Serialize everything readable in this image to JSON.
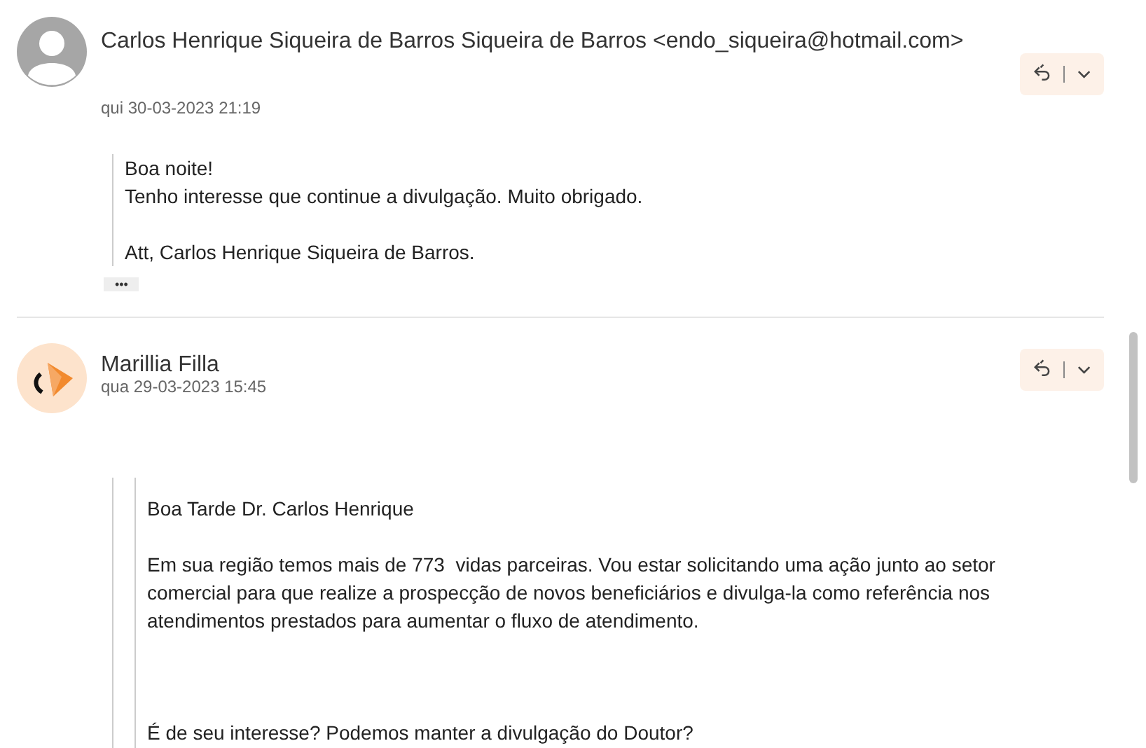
{
  "messages": [
    {
      "sender": "Carlos Henrique Siqueira de Barros Siqueira de Barros <endo_siqueira@hotmail.com>",
      "date": "qui 30-03-2023 21:19",
      "avatar": {
        "kind": "person"
      },
      "quote": {
        "kind": "single"
      },
      "show_more": "•••",
      "paragraphs": [
        {
          "kind": "normal",
          "lines": [
            "Boa noite!",
            "Tenho interesse que continue a divulgação. Muito obrigado."
          ]
        },
        {
          "kind": "normal",
          "lines": [
            "Att, Carlos Henrique Siqueira de Barros."
          ]
        }
      ]
    },
    {
      "sender": "Marillia Filla",
      "date": "qua 29-03-2023 15:45",
      "avatar": {
        "kind": "logo"
      },
      "quote": {
        "kind": "double"
      },
      "paragraphs": [
        {
          "kind": "normal",
          "lines": [
            "Boa Tarde Dr. Carlos Henrique"
          ]
        },
        {
          "kind": "normal",
          "lines": [
            "Em sua região temos mais de 773  vidas parceiras. Vou estar solicitando uma ação junto ao setor comercial para que realize a prospecção de novos beneficiários e divulga-la como referência nos atendimentos prestados para aumentar o fluxo de atendimento."
          ]
        },
        {
          "kind": "spaced",
          "lines": [
            "É de seu interesse? Podemos manter a divulgação do Doutor?"
          ]
        }
      ]
    }
  ]
}
